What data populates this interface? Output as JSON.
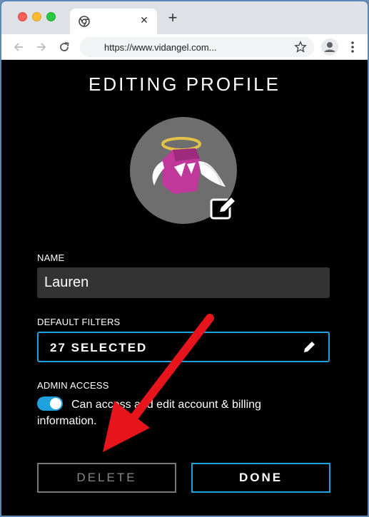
{
  "browser": {
    "url": "https://www.vidangel.com...",
    "new_tab_glyph": "+",
    "close_tab_glyph": "✕",
    "icons": [
      "chrome-icon",
      "back-arrow-icon",
      "forward-arrow-icon",
      "reload-icon",
      "star-icon",
      "profile-icon",
      "menu-dots-icon"
    ]
  },
  "page": {
    "title": "EDITING PROFILE",
    "name_label": "NAME",
    "name_value": "Lauren",
    "filters_label": "DEFAULT FILTERS",
    "filters_value": "27 SELECTED",
    "admin_label": "ADMIN ACCESS",
    "admin_description": "Can access and edit account & billing information.",
    "admin_toggle_on": true,
    "delete_label": "DELETE",
    "done_label": "DONE"
  },
  "colors": {
    "accent": "#1ea1dc",
    "background": "#000000",
    "arrow": "#e8141b",
    "avatar_bg": "#6e6e6e",
    "mascot": "#c0399a"
  }
}
